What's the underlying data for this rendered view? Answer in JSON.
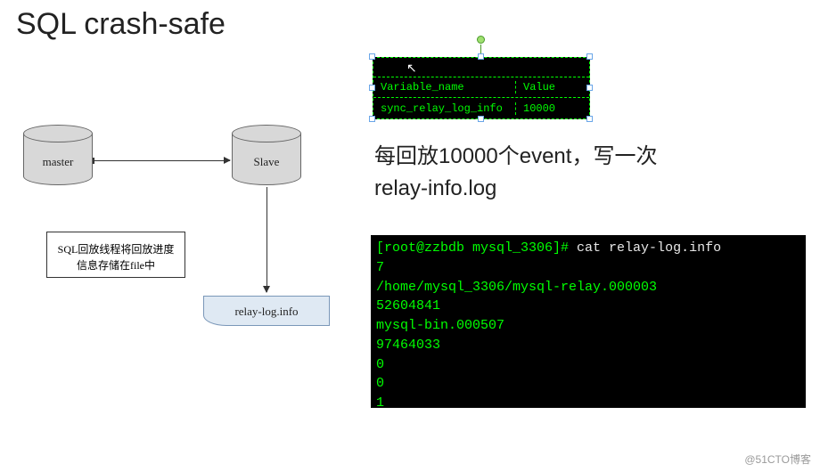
{
  "title": "SQL crash-safe",
  "diagram": {
    "master_label": "master",
    "slave_label": "Slave",
    "note_line1": "SQL回放线程将回放进度",
    "note_line2": "信息存储在file中",
    "relay_file_label": "relay-log.info"
  },
  "var_table": {
    "header_col1": "Variable_name",
    "header_col2": "Value",
    "row_col1": "sync_relay_log_info",
    "row_col2": "10000"
  },
  "caption": {
    "line1": "每回放10000个event，写一次",
    "line2": "relay-info.log"
  },
  "terminal": {
    "prompt": "[root@zzbdb mysql_3306]# ",
    "command": "cat relay-log.info",
    "out1": "7",
    "out2": "/home/mysql_3306/mysql-relay.000003",
    "out3": "52604841",
    "out4": "mysql-bin.000507",
    "out5": "97464033",
    "out6": "0",
    "out7": "0",
    "out8": "1"
  },
  "watermark": "@51CTO博客"
}
